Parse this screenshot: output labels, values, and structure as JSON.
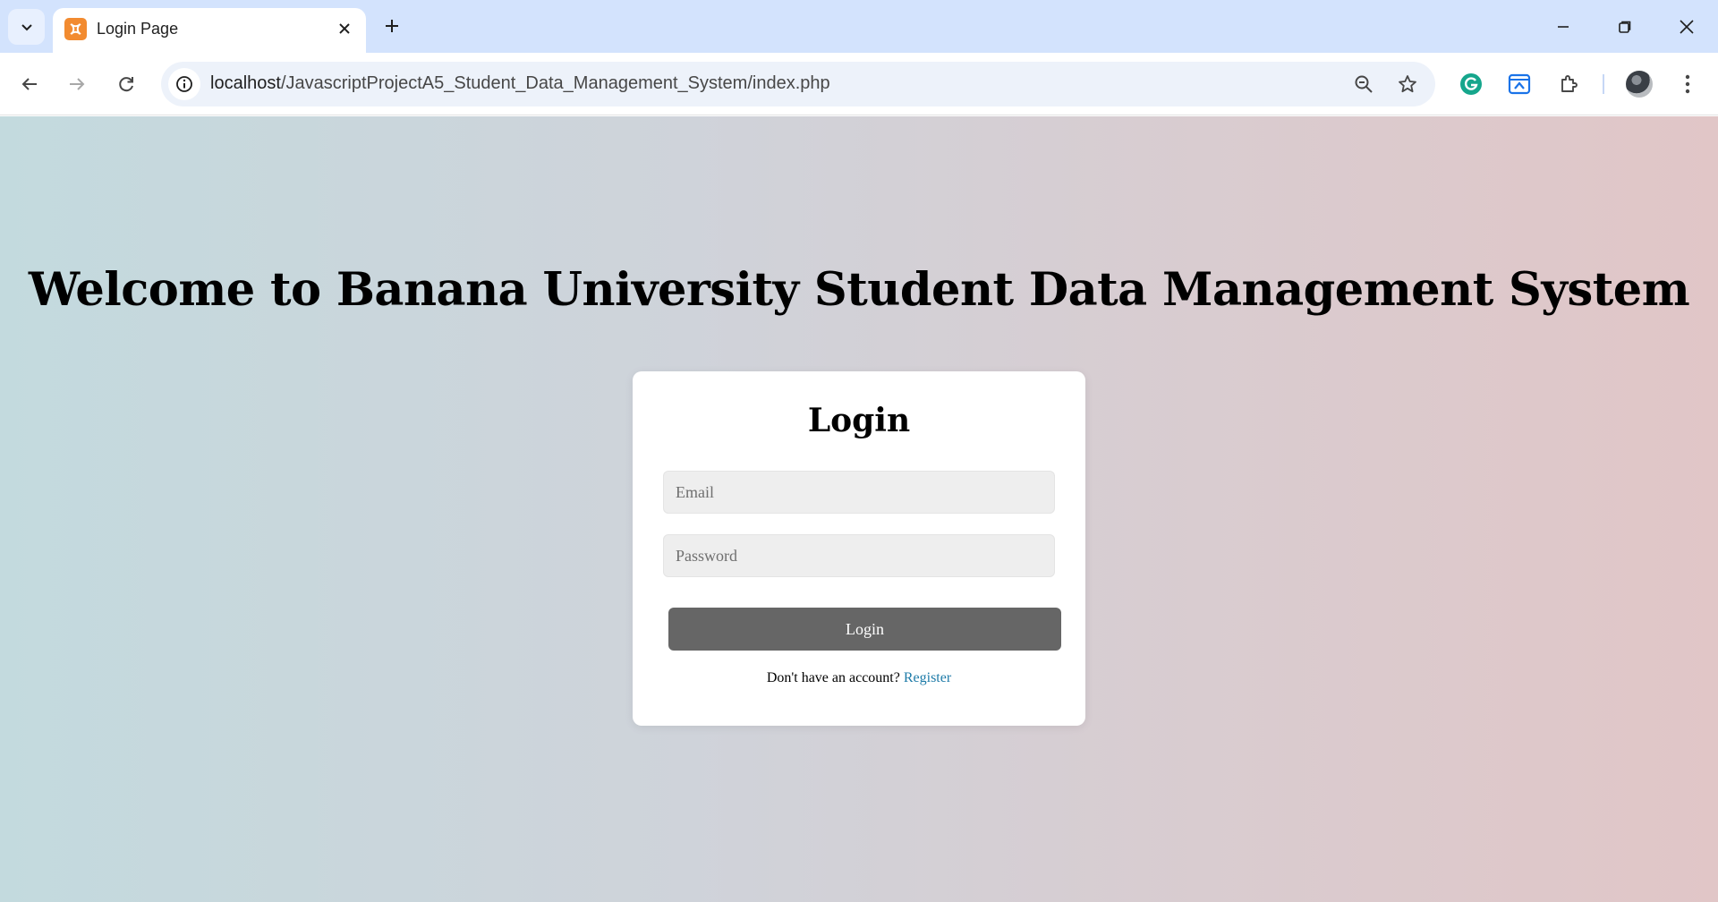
{
  "browser": {
    "tab": {
      "title": "Login Page"
    },
    "url": {
      "host": "localhost",
      "path": "/JavascriptProjectA5_Student_Data_Management_System/index.php"
    }
  },
  "page": {
    "heading": "Welcome to Banana University Student Data Management System",
    "login_card": {
      "title": "Login",
      "email_placeholder": "Email",
      "password_placeholder": "Password",
      "submit_label": "Login",
      "register_prompt": "Don't have an account?",
      "register_link": "Register"
    }
  },
  "colors": {
    "tabstrip": "#d3e3fd",
    "button": "#666666",
    "link": "#1e7ba8",
    "favicon": "#f28b30"
  }
}
